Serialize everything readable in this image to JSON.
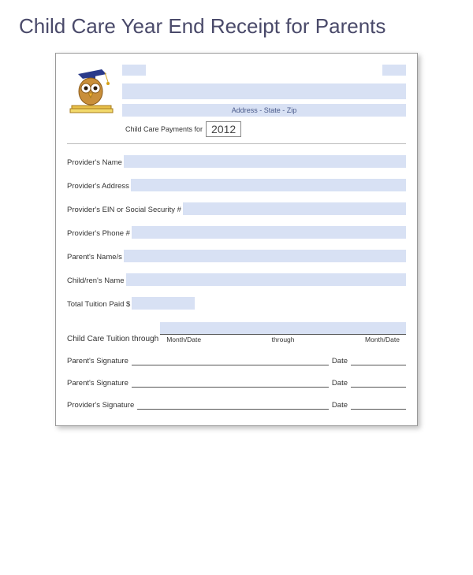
{
  "title": "Child Care Year End Receipt for Parents",
  "header": {
    "address_placeholder": "Address - State - Zip",
    "payments_label": "Child Care Payments for",
    "year": "2012"
  },
  "fields": {
    "provider_name": "Provider's Name",
    "provider_address": "Provider's Address",
    "provider_ein": "Provider's EIN or Social Security #",
    "provider_phone": "Provider's Phone #",
    "parents_names": "Parent's Name/s",
    "childrens_name": "Child/ren's Name",
    "total_tuition": "Total Tuition Paid $",
    "tuition_through": "Child Care Tuition through",
    "month_date": "Month/Date",
    "through": "through"
  },
  "signatures": {
    "parent": "Parent's Signature",
    "provider": "Provider's Signature",
    "date": "Date"
  }
}
